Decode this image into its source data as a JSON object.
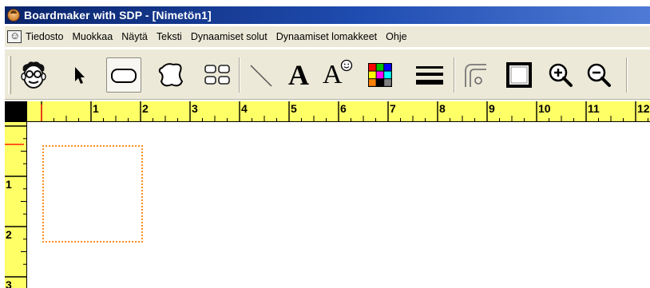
{
  "window": {
    "title": "Boardmaker with SDP - [Nimetön1]",
    "app_icon": "boardmaker-face-icon"
  },
  "menu": {
    "doc_icon": "document-face-icon",
    "items": [
      {
        "label": "Tiedosto"
      },
      {
        "label": "Muokkaa"
      },
      {
        "label": "Näytä"
      },
      {
        "label": "Teksti"
      },
      {
        "label": "Dynaamiset solut"
      },
      {
        "label": "Dynaamiset lomakkeet"
      },
      {
        "label": "Ohje"
      }
    ]
  },
  "toolbar": {
    "tools": [
      {
        "icon": "symbol-finder-face-icon",
        "pressed": false
      },
      {
        "icon": "pointer-arrow-icon",
        "pressed": false
      },
      {
        "icon": "rounded-rectangle-icon",
        "pressed": true
      },
      {
        "icon": "freeform-shape-icon",
        "pressed": false
      },
      {
        "icon": "grid-cells-icon",
        "pressed": false
      },
      {
        "icon": "line-tool-icon",
        "pressed": false
      },
      {
        "icon": "text-tool-icon",
        "pressed": false,
        "glyph": "A"
      },
      {
        "icon": "symbol-text-icon",
        "pressed": false,
        "glyph": "A"
      },
      {
        "icon": "color-palette-icon",
        "pressed": false
      },
      {
        "icon": "line-thickness-icon",
        "pressed": false
      },
      {
        "icon": "corner-style-icon",
        "pressed": false
      },
      {
        "icon": "border-style-icon",
        "pressed": false
      },
      {
        "icon": "zoom-in-icon",
        "pressed": false
      },
      {
        "icon": "zoom-out-icon",
        "pressed": false
      }
    ],
    "palette_colors": [
      "#ff0000",
      "#00c000",
      "#0000ff",
      "#ffff00",
      "#ff00ff",
      "#00ffff",
      "#ff8000",
      "#000000",
      "#808080"
    ]
  },
  "ruler": {
    "horizontal_labels": [
      "1",
      "2",
      "3",
      "4",
      "5",
      "6",
      "7",
      "8",
      "9",
      "10",
      "11",
      "12"
    ],
    "vertical_labels": [
      "1",
      "2",
      "3"
    ],
    "color": "#ffff66"
  },
  "canvas": {
    "cell_border_color": "#ff8c1a",
    "cell_style": "dotted"
  }
}
